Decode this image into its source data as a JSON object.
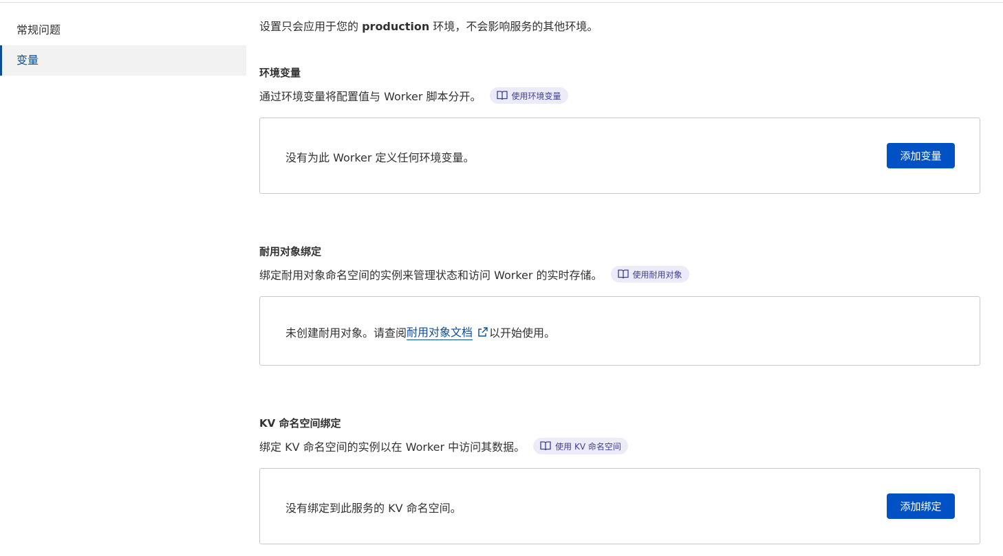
{
  "sidebar": {
    "items": [
      {
        "label": "常规问题",
        "active": false
      },
      {
        "label": "变量",
        "active": true
      }
    ]
  },
  "intro": {
    "prefix": "设置只会应用于您的 ",
    "env": "production",
    "suffix": " 环境，不会影响服务的其他环境。"
  },
  "sections": {
    "env_vars": {
      "title": "环境变量",
      "description": "通过环境变量将配置值与 Worker 脚本分开。",
      "doc_link": "使用环境变量",
      "empty_text": "没有为此 Worker 定义任何环境变量。",
      "button": "添加变量"
    },
    "durable": {
      "title": "耐用对象绑定",
      "description": "绑定耐用对象命名空间的实例来管理状态和访问 Worker 的实时存储。",
      "doc_link": "使用耐用对象",
      "empty_prefix": "未创建耐用对象。请查阅",
      "empty_link": "耐用对象文档",
      "empty_suffix": "以开始使用。"
    },
    "kv": {
      "title": "KV 命名空间绑定",
      "description": "绑定 KV 命名空间的实例以在 Worker 中访问其数据。",
      "doc_link": "使用 KV 命名空间",
      "empty_text": "没有绑定到此服务的 KV 命名空间。",
      "button": "添加绑定"
    }
  },
  "icons": {
    "doc": "book-icon",
    "external": "external-link-icon"
  },
  "colors": {
    "primary": "#0051c3",
    "pill_bg": "#ecebf9",
    "pill_text": "#3e3d96",
    "link": "#0b4d96"
  }
}
